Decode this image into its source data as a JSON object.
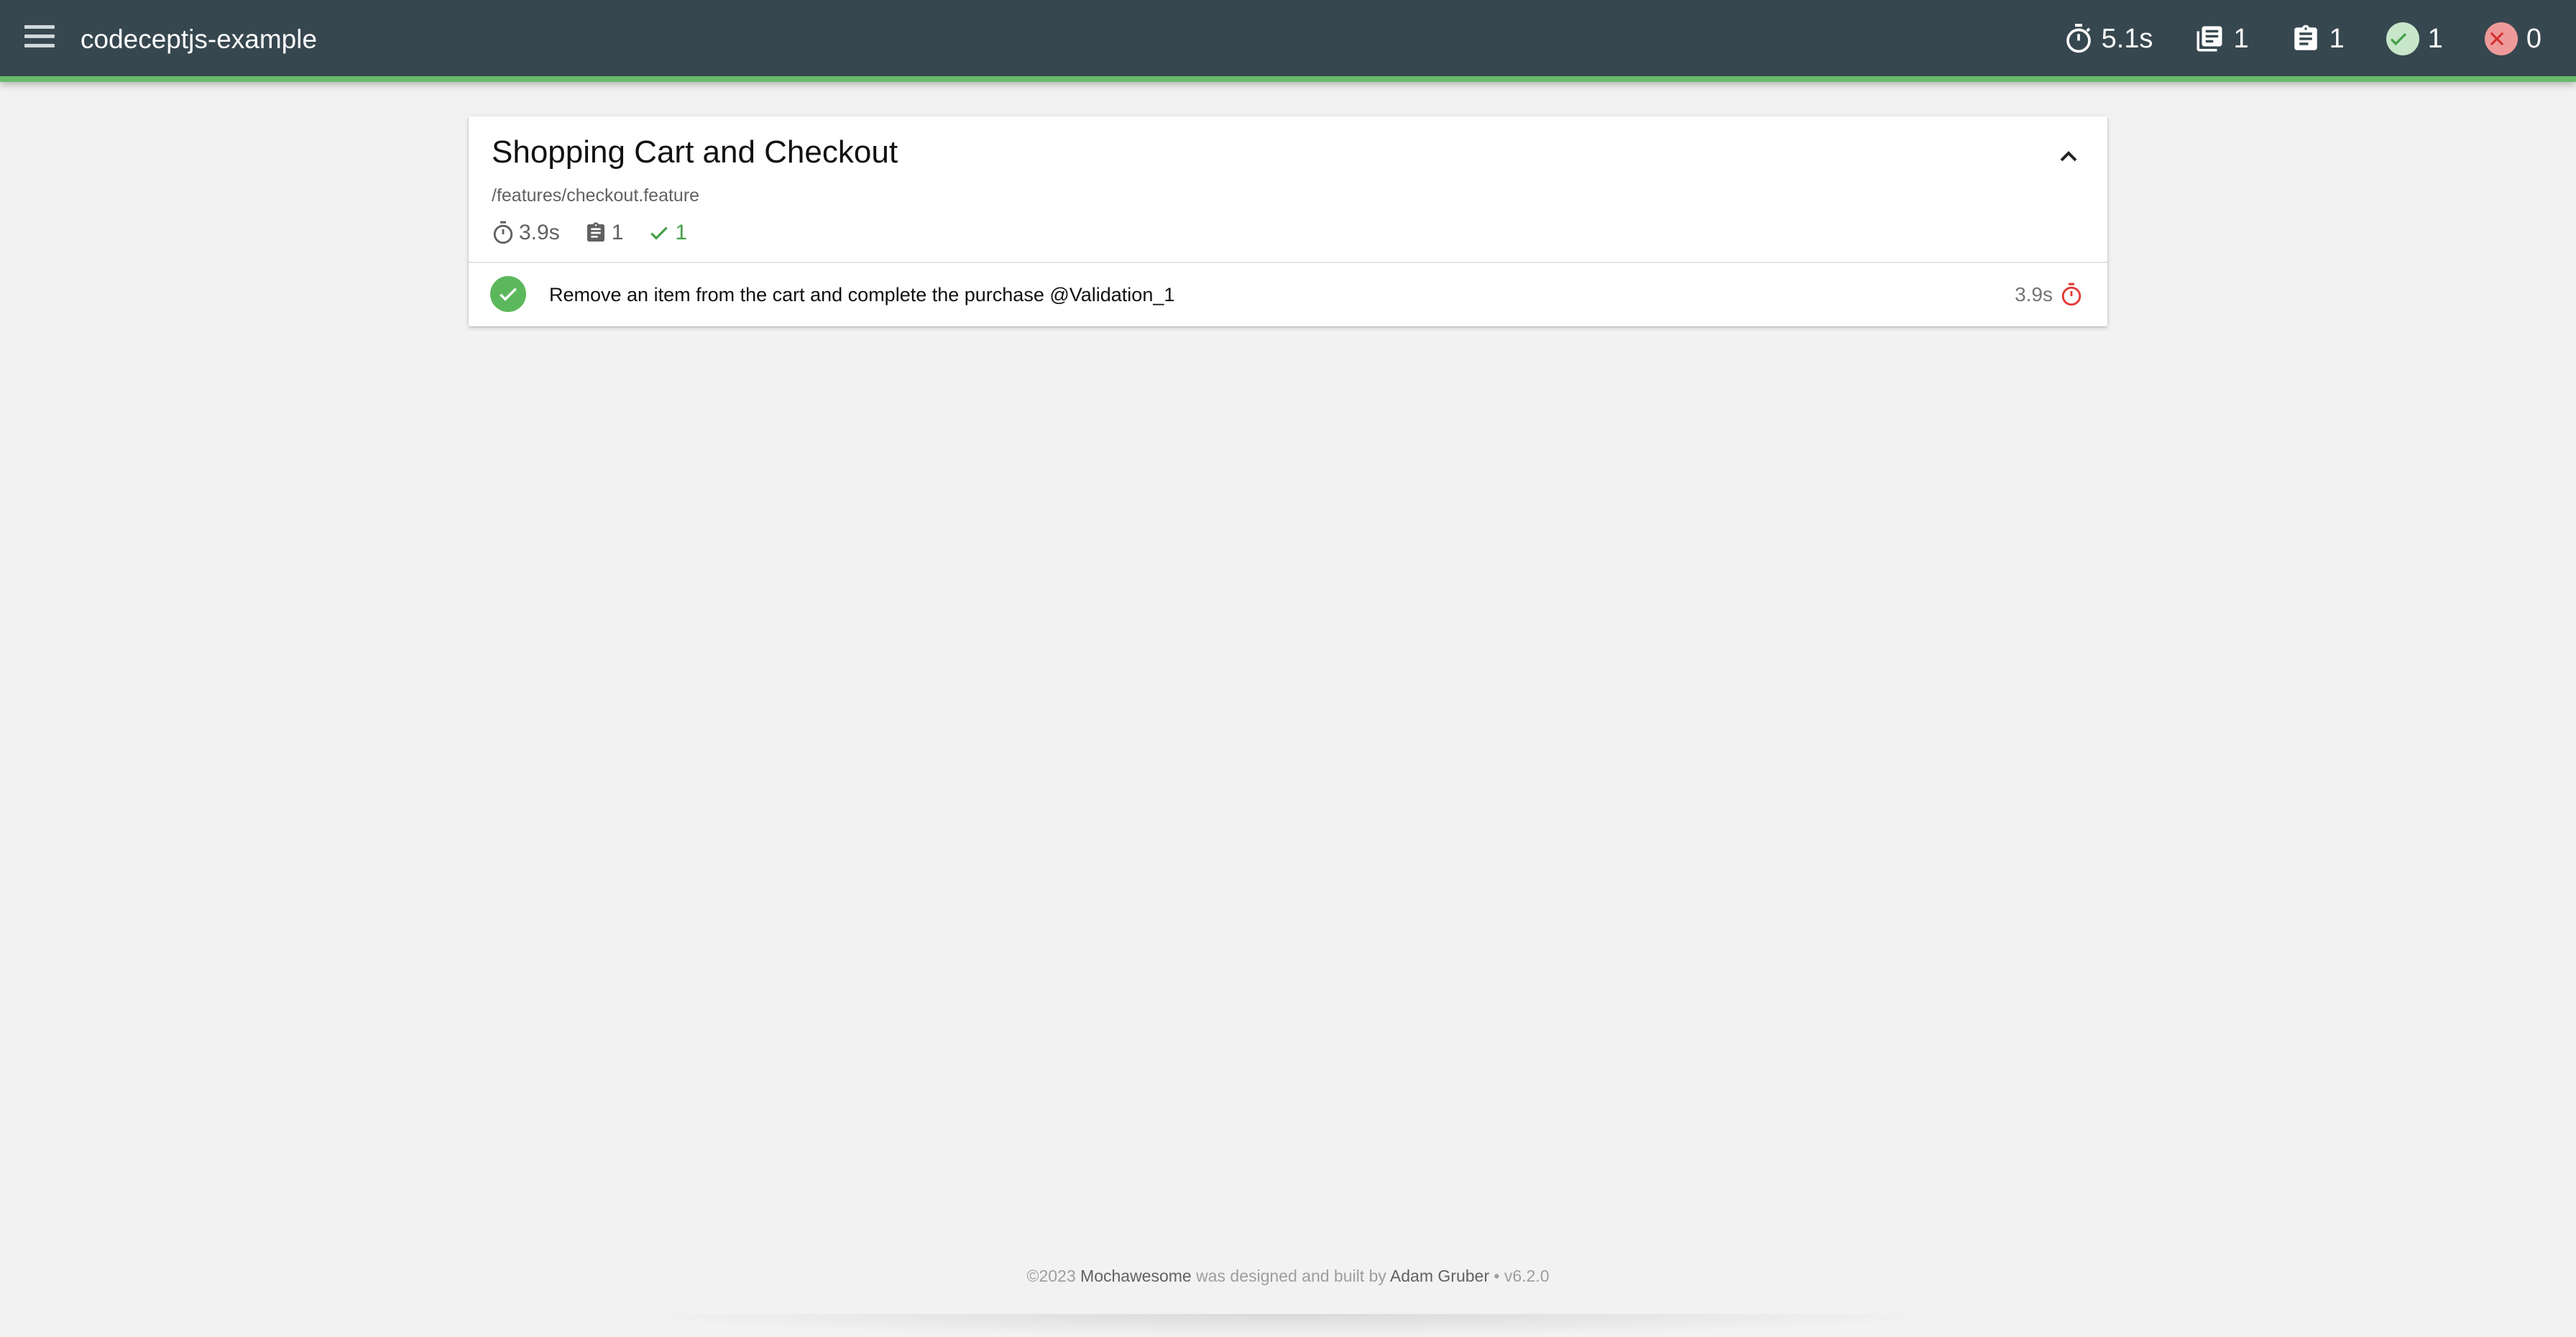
{
  "navbar": {
    "title": "codeceptjs-example",
    "stats": {
      "duration": "5.1s",
      "suites": "1",
      "tests": "1",
      "passes": "1",
      "failures": "0"
    }
  },
  "suite": {
    "title": "Shopping Cart and Checkout",
    "file": "/features/checkout.feature",
    "stats": {
      "duration": "3.9s",
      "tests": "1",
      "passes": "1"
    },
    "tests": [
      {
        "title": "Remove an item from the cart and complete the purchase @Validation_1",
        "duration": "3.9s",
        "state": "passed"
      }
    ]
  },
  "footer": {
    "copyright": "©2023",
    "product": "Mochawesome",
    "middle": "was designed and built by",
    "author": "Adam Gruber",
    "separator": "•",
    "version": "v6.2.0"
  },
  "colors": {
    "navbar": "#37474f",
    "pass": "#5cb85c",
    "accent_green": "#66bb6a",
    "fail": "#ef9a9a",
    "slow": "#e53935"
  }
}
